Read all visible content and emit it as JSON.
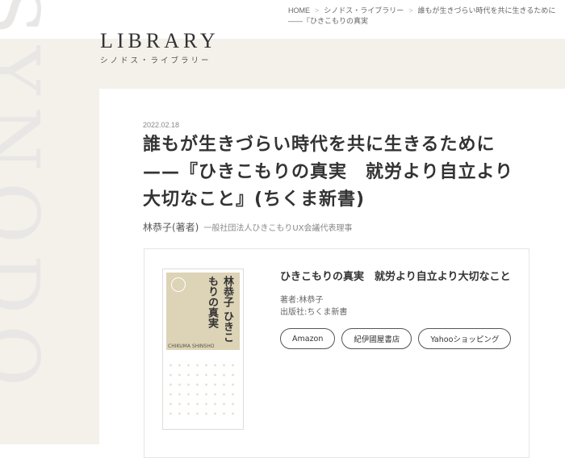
{
  "breadcrumb": {
    "home": "HOME",
    "section": "シノドス・ライブラリー",
    "current": "誰もが生きづらい時代を共に生きるために ——『ひきこもりの真実"
  },
  "watermark": "SYNODOS",
  "header": {
    "logo": "LIBRARY",
    "subtitle": "シノドス・ライブラリー"
  },
  "article": {
    "date": "2022.02.18",
    "title": "誰もが生きづらい時代を共に生きるために——『ひきこもりの真実　就労より自立より大切なこと』(ちくま新書)",
    "author": "林恭子(著者)",
    "author_role": "一般社団法人ひきこもりUX会議代表理事"
  },
  "book": {
    "cover_title": "林恭子 ひきこもりの真実",
    "cover_series": "CHIKUMA SHINSHO",
    "title": "ひきこもりの真実　就労より自立より大切なこと",
    "author": "著者:林恭子",
    "publisher": "出版社:ちくま新書",
    "buttons": [
      "Amazon",
      "紀伊國屋書店",
      "Yahooショッピング"
    ]
  }
}
